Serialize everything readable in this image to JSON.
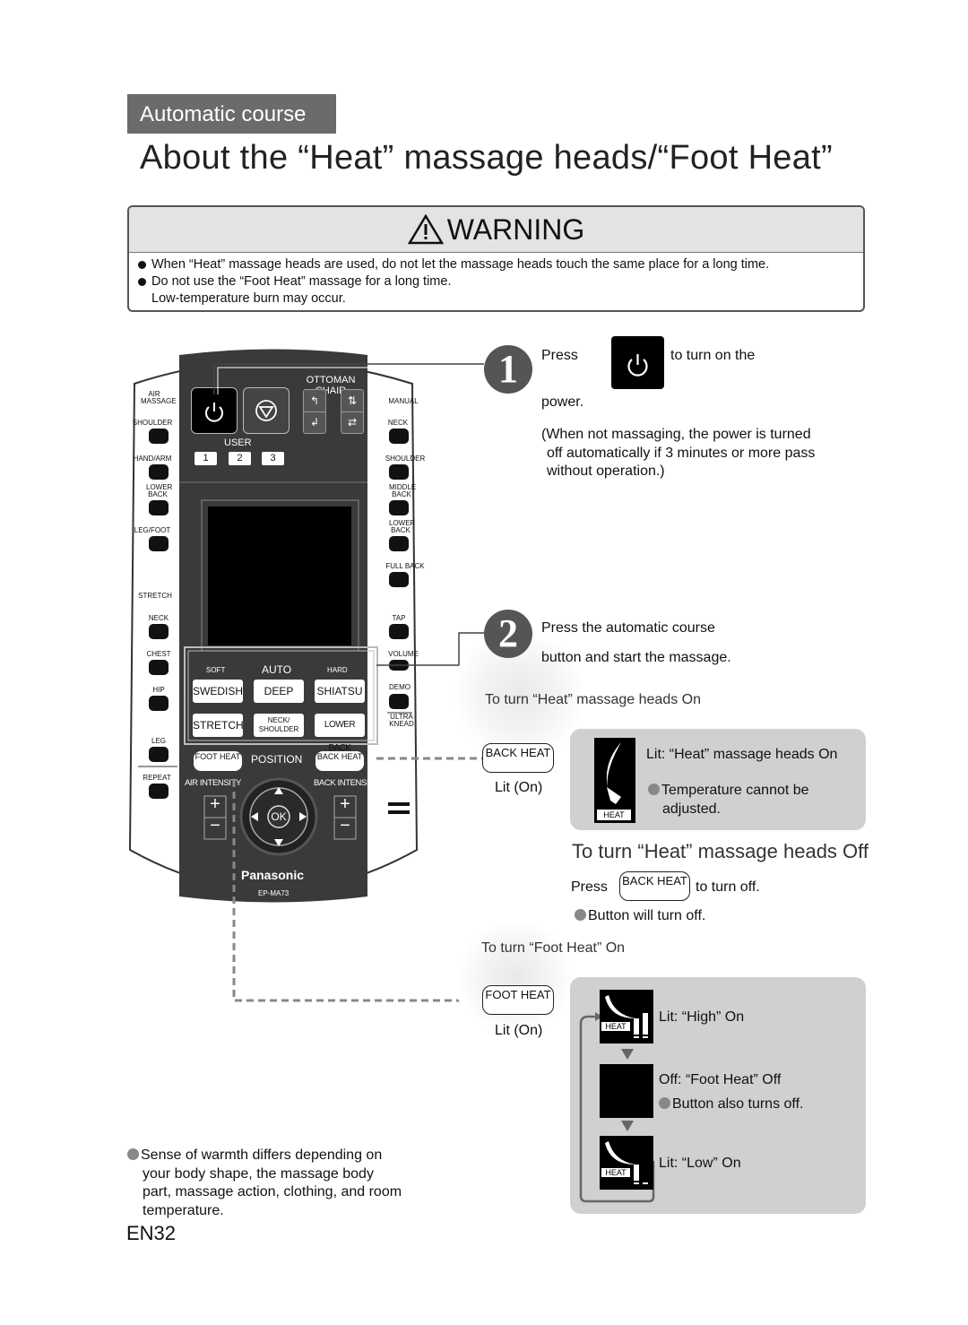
{
  "section_tab": "Automatic course",
  "page_title": "About the “Heat” massage heads/“Foot Heat”",
  "warning": {
    "title": "WARNING",
    "items": [
      "When “Heat” massage heads are used, do not let the massage heads touch the same place for a long time.",
      "Do not use the  “Foot Heat” massage for a long time."
    ],
    "note": "Low-temperature burn may occur."
  },
  "remote": {
    "top_labels": {
      "ottoman_chair": "OTTOMAN CHAIR",
      "user": "USER"
    },
    "user_buttons": [
      "1",
      "2",
      "3"
    ],
    "left_labels": [
      "AIR MASSAGE",
      "SHOULDER",
      "HAND/ARM",
      "LOWER BACK",
      "LEG/FOOT",
      "STRETCH",
      "NECK",
      "CHEST",
      "HIP",
      "LEG",
      "REPEAT"
    ],
    "right_labels": [
      "MANUAL",
      "NECK",
      "SHOULDER",
      "MIDDLE BACK",
      "LOWER BACK",
      "FULL BACK",
      "TAP",
      "VOLUME",
      "DEMO",
      "ULTRA KNEAD"
    ],
    "auto": {
      "soft": "SOFT",
      "auto": "AUTO",
      "hard": "HARD"
    },
    "course_buttons": [
      "SWEDISH",
      "DEEP",
      "SHIATSU",
      "STRETCH",
      "NECK/ SHOULDER",
      "LOWER BACK"
    ],
    "foot_heat": "FOOT HEAT",
    "position": "POSITION",
    "back_heat": "BACK HEAT",
    "air_intensity": "AIR INTENSITY",
    "back_intensity": "BACK INTENSITY",
    "ok": "OK",
    "plus": "+",
    "minus": "−",
    "brand": "Panasonic",
    "model": "EP-MA73"
  },
  "step1": {
    "number": "1",
    "press": "Press",
    "rest": "to turn on the",
    "line2": "power.",
    "note": [
      "(When not massaging, the power is turned",
      "off automatically if 3 minutes or more pass",
      "without operation.)"
    ]
  },
  "step2": {
    "number": "2",
    "lines": [
      "Press the automatic course",
      "button and start the massage."
    ]
  },
  "heat_on": {
    "heading": "To turn “Heat” massage heads On",
    "button": "BACK HEAT",
    "button_state": "Lit (On)",
    "icon_label": "HEAT",
    "lit_text": "Lit: “Heat” massage heads On",
    "note": [
      "Temperature cannot be",
      "adjusted."
    ]
  },
  "heat_off": {
    "heading": "To turn “Heat” massage heads Off",
    "press": "Press",
    "button": "BACK HEAT",
    "rest": "to turn off.",
    "note": "Button will turn off."
  },
  "foot_on": {
    "heading": "To turn “Foot Heat” On",
    "button": "FOOT HEAT",
    "button_state": "Lit (On)",
    "icon_label": "HEAT",
    "states": [
      {
        "text": "Lit: “High” On"
      },
      {
        "text": "Off: “Foot Heat” Off",
        "note": "Button also turns off."
      },
      {
        "text": "Lit: “Low” On"
      }
    ]
  },
  "footnote": [
    "Sense of warmth differs depending on",
    "your body shape, the massage body",
    "part, massage action, clothing, and room",
    "temperature."
  ],
  "page_number": "EN32"
}
